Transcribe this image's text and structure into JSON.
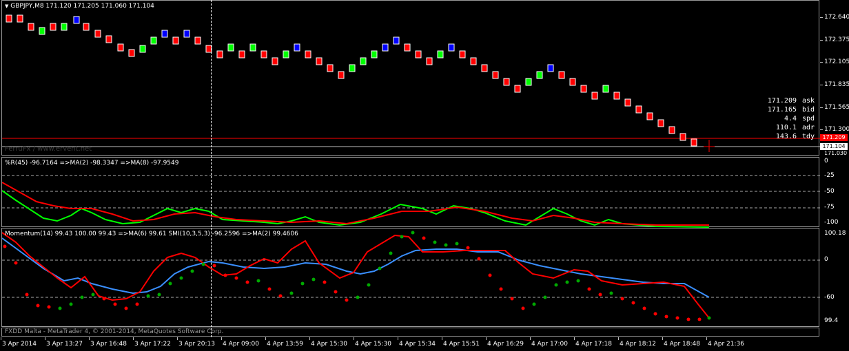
{
  "main_chart": {
    "header": "GBPJPY,M8  171.120 171.205 171.060 171.104",
    "watermark": "FerruFx / www.ervent.net",
    "price_ticks": [
      "172.640",
      "172.375",
      "172.105",
      "171.835",
      "171.565",
      "171.300",
      "171.030"
    ],
    "ask_tag": "171.209",
    "bid_tag": "171.104",
    "info_panel": [
      {
        "value": "171.209",
        "key": "ask"
      },
      {
        "value": "171.165",
        "key": "bid"
      },
      {
        "value": "4.4",
        "key": "spd"
      },
      {
        "value": "110.1",
        "key": "adr"
      },
      {
        "value": "143.6",
        "key": "tdy"
      }
    ],
    "colors": {
      "bear": "#ff0000",
      "bull_green": "#00ff00",
      "bull_blue": "#0000ff",
      "ask_line": "#ff0000",
      "bid_line": "#c0c0c0"
    }
  },
  "wpr_panel": {
    "label": "%R(45) -96.7164  =>MA(2) -98.3347  =>MA(8) -97.9549",
    "ticks": [
      "0",
      "-25",
      "-50",
      "-75",
      "-100"
    ]
  },
  "momentum_panel": {
    "label": "Momentum(14) 99.43 100.00 99.43  =>MA(6) 99.61  SMI(10,3,5,3) -96.2596  =>MA(2) 99.4606",
    "ticks": [
      "100.18",
      "0",
      "-60",
      "99.4"
    ]
  },
  "footer_text": "FXDD Malta - MetaTrader 4, © 2001-2014, MetaQuotes Software Corp.",
  "time_axis": [
    "3 Apr 2014",
    "3 Apr 13:27",
    "3 Apr 16:48",
    "3 Apr 17:22",
    "3 Apr 20:13",
    "4 Apr 09:00",
    "4 Apr 13:59",
    "4 Apr 15:30",
    "4 Apr 15:30",
    "4 Apr 15:34",
    "4 Apr 15:51",
    "4 Apr 16:29",
    "4 Apr 17:00",
    "4 Apr 17:18",
    "4 Apr 18:12",
    "4 Apr 18:48",
    "4 Apr 21:36"
  ]
}
